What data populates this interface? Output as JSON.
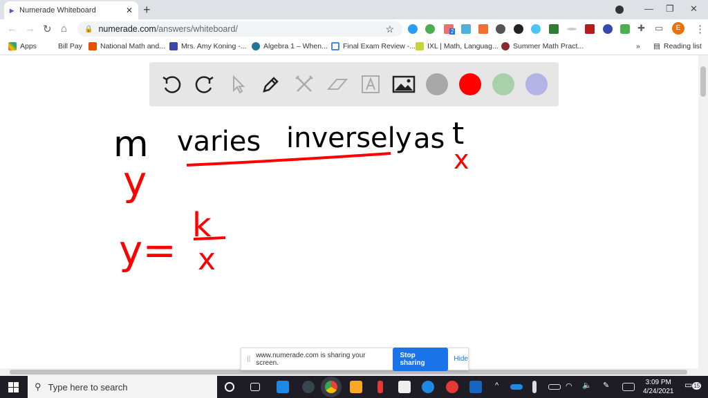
{
  "browser": {
    "tab_title": "Numerade Whiteboard",
    "url_domain": "numerade.com",
    "url_path": "/answers/whiteboard/",
    "profile_initial": "E",
    "bookmarks": [
      "Apps",
      "Bill Pay",
      "National Math and...",
      "Mrs. Amy Koning -...",
      "Algebra 1 – When...",
      "Final Exam Review -...",
      "IXL | Math, Languag...",
      "Summer Math Pract..."
    ],
    "more_bookmarks": "»",
    "reading_list": "Reading list",
    "ext_badge": "2"
  },
  "toolbar": {
    "tools": [
      "undo",
      "redo",
      "select",
      "pen",
      "tools",
      "eraser",
      "text",
      "image"
    ],
    "colors": [
      "#a8a8a8",
      "#ff0000",
      "#a9d1a9",
      "#b3b3e6"
    ]
  },
  "whiteboard": {
    "line1": {
      "m": "m",
      "varies": "varies",
      "inversely": "inversely",
      "as": "as",
      "t": "t"
    },
    "x_label": "x",
    "y_label": "y",
    "equation_lhs": "y=",
    "numerator": "k",
    "denominator": "x"
  },
  "share_banner": {
    "message": "www.numerade.com is sharing your screen.",
    "stop": "Stop sharing",
    "hide": "Hide"
  },
  "taskbar": {
    "search_placeholder": "Type here to search",
    "time": "3:09 PM",
    "date": "4/24/2021",
    "notifications": "15"
  }
}
